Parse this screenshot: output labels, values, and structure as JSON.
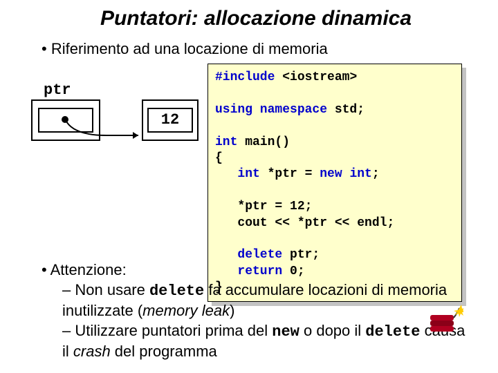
{
  "title": "Puntatori: allocazione dinamica",
  "bullet_main": "Riferimento ad una locazione di memoria",
  "diagram": {
    "ptr_label": "ptr",
    "value": "12"
  },
  "code": {
    "l1a": "#include",
    "l1b": " <iostream>",
    "l2a": "using namespace",
    "l2b": " std;",
    "l3a": "int",
    "l3b": " main()",
    "l4": "{",
    "l5a": "   int",
    "l5b": " *ptr = ",
    "l5c": "new int",
    "l5d": ";",
    "blank1": "",
    "l6": "   *ptr = 12;",
    "l7": "   cout << *ptr << endl;",
    "blank2": "",
    "l8a": "   delete",
    "l8b": " ptr;",
    "l9a": "   return",
    "l9b": " 0;",
    "l10": "}"
  },
  "lower": {
    "attenzione": "Attenzione:",
    "sub1_a": "Non usare ",
    "sub1_code": "delete",
    "sub1_b": " fa accumulare locazioni di memoria inutilizzate (",
    "sub1_it": "memory leak",
    "sub1_c": ")",
    "sub2_a": "Utilizzare puntatori prima del ",
    "sub2_code1": "new",
    "sub2_b": " o dopo il ",
    "sub2_code2": "delete",
    "sub2_c": " causa il ",
    "sub2_it": "crash",
    "sub2_d": " del programma"
  }
}
